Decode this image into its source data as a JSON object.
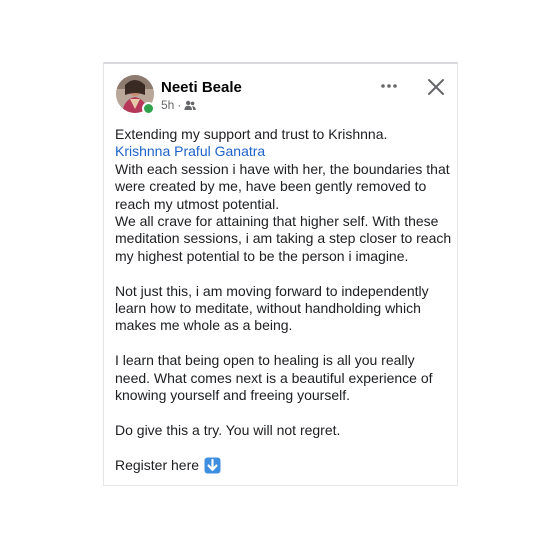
{
  "post": {
    "author": "Neeti Beale",
    "time": "5h",
    "separator": "·",
    "audience_icon": "friends-icon",
    "online_status_color": "#31a24c",
    "link_color": "#1d63c9",
    "text": {
      "line1": "Extending my support and trust to Krishnna.",
      "mention": "Krishnna Praful Ganatra",
      "para1": "With each session i have with her, the boundaries that were created by me, have been gently removed to reach my utmost potential.",
      "para2": "We all crave for attaining that higher self. With these meditation sessions, i am taking a step closer to reach my highest potential to be the person i imagine.",
      "para3": "Not just this, i am moving forward to independently learn how to meditate, without handholding which makes me whole as a being.",
      "para4": "I learn that being open to healing is all you really need. What comes next is a beautiful experience of knowing yourself and freeing yourself.",
      "para5": "Do give this a try. You will not regret.",
      "register": "Register here",
      "register_emoji": "down-arrow-emoji"
    }
  }
}
